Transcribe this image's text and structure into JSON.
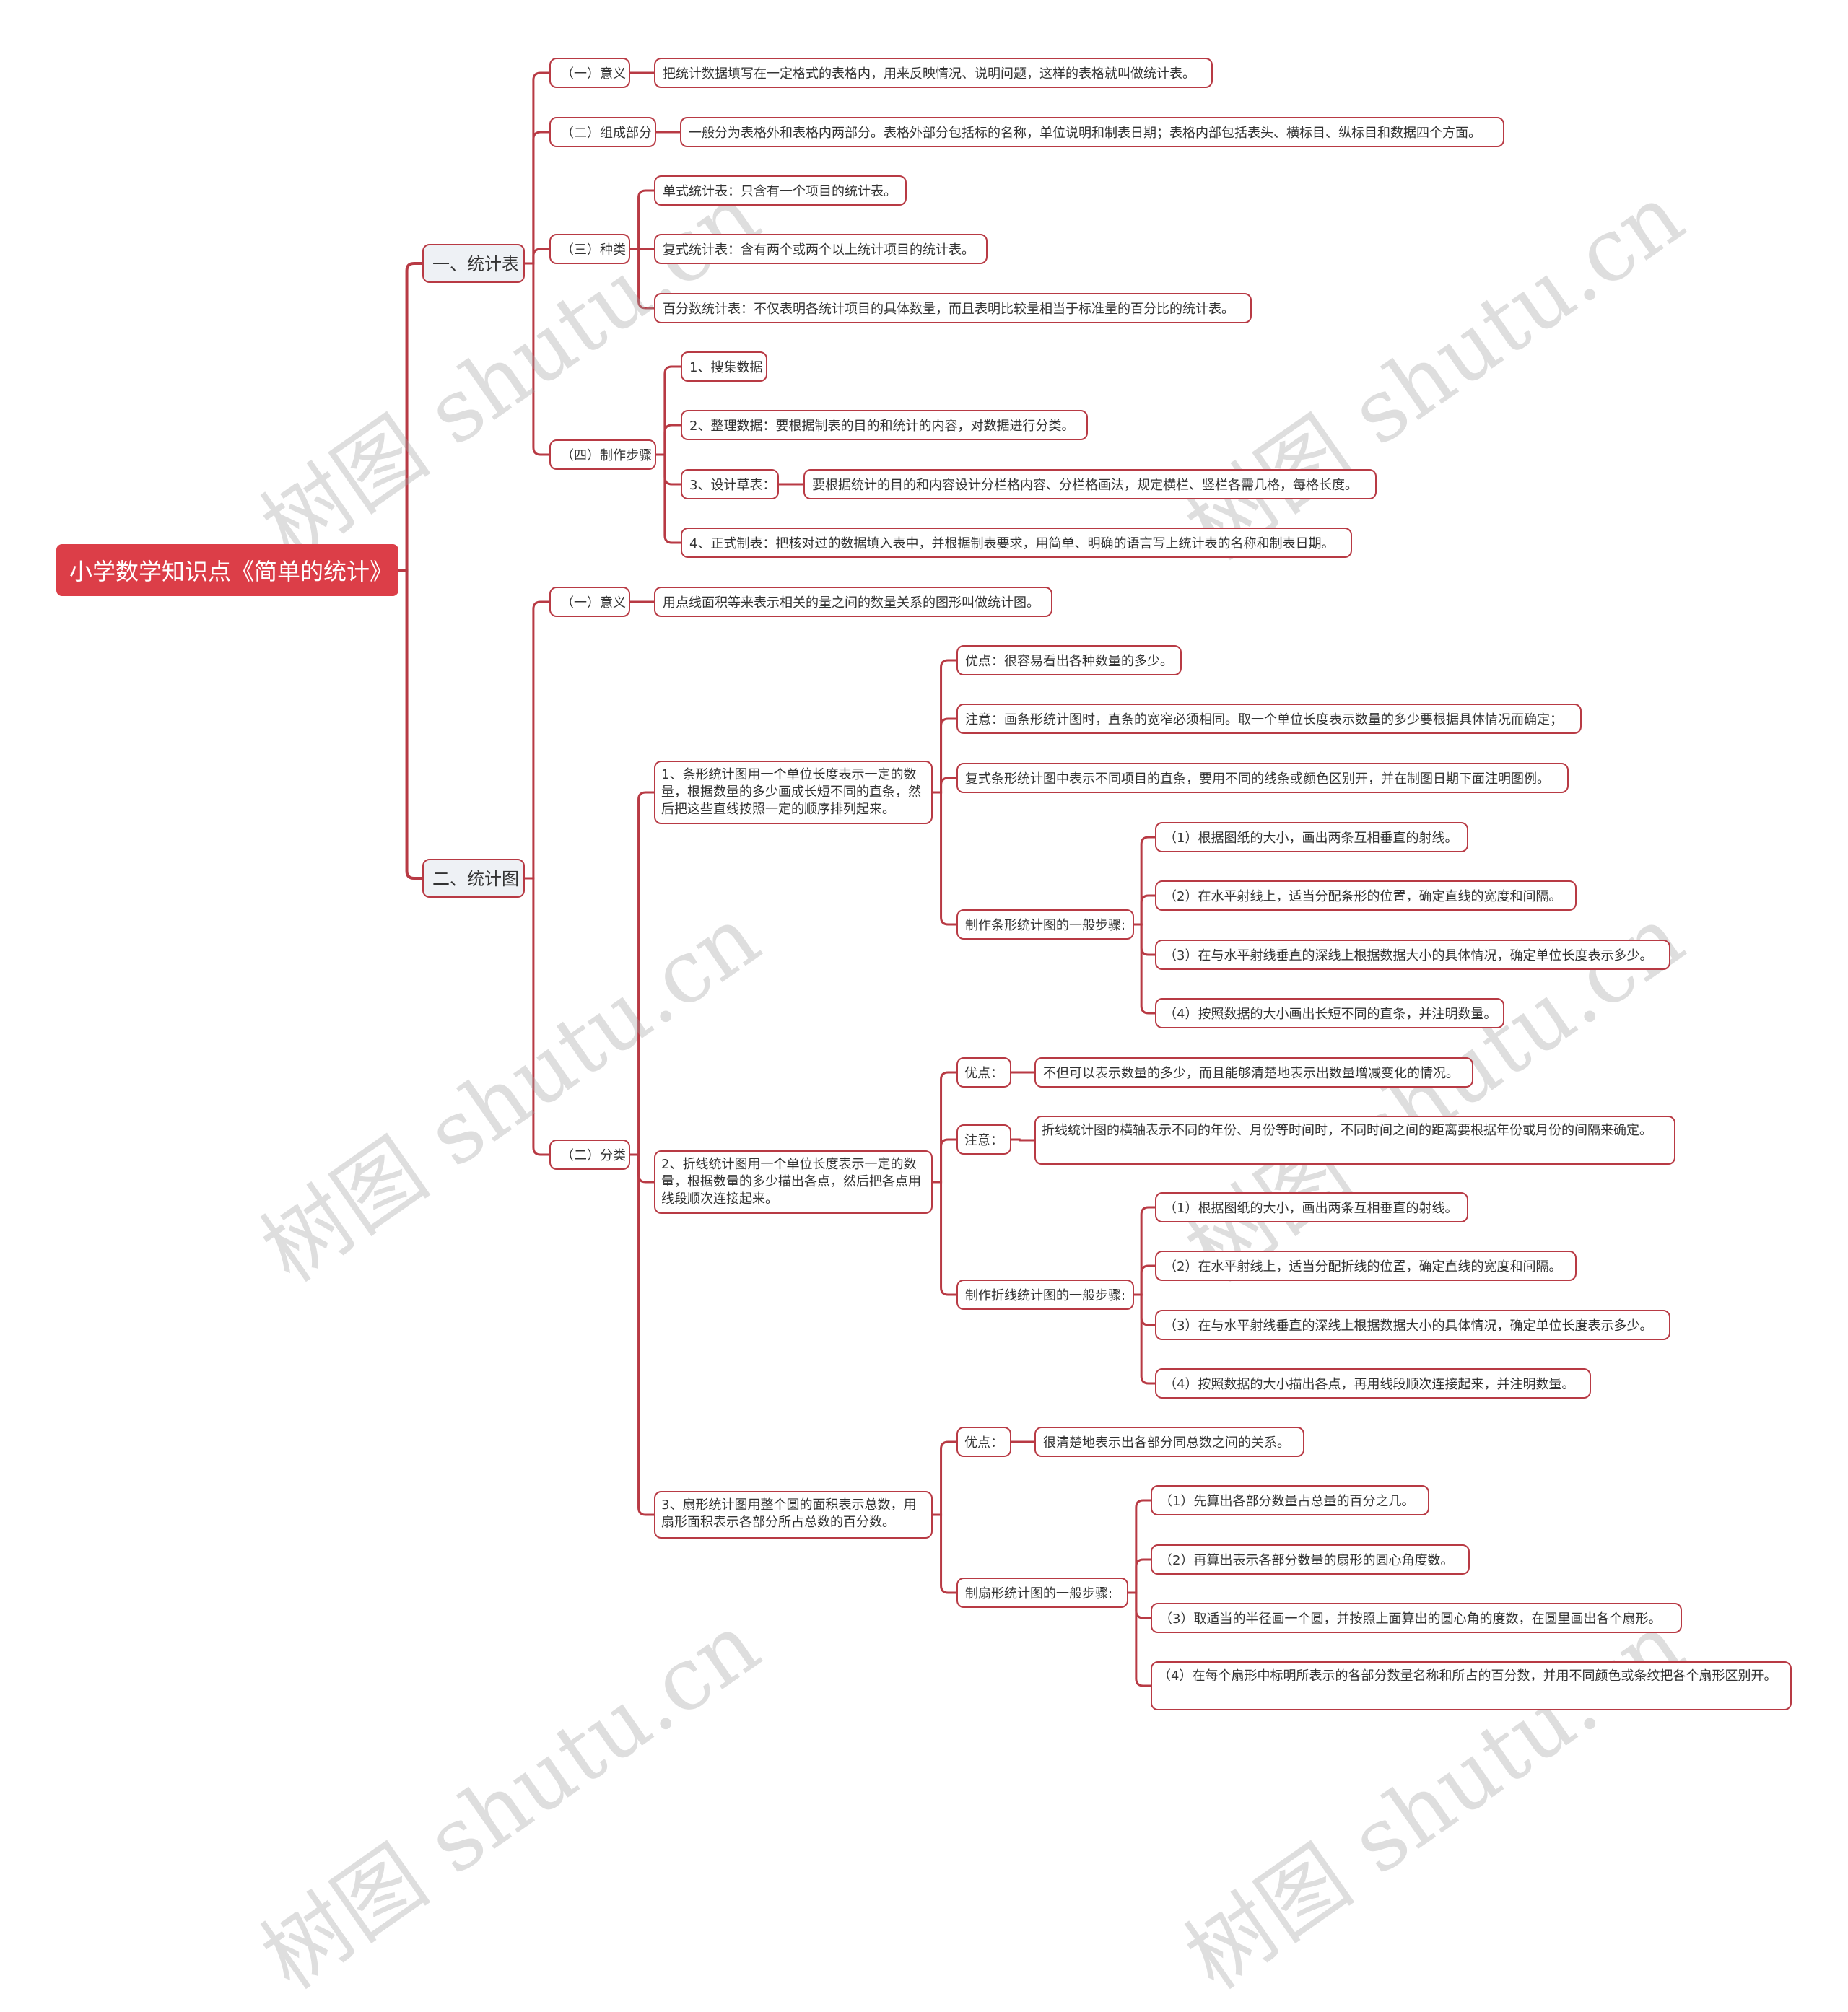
{
  "root": "小学数学知识点《简单的统计》",
  "branches": [
    {
      "label": "一、统计表",
      "children": [
        {
          "label": "（一）意义",
          "detail": "把统计数据填写在一定格式的表格内，用来反映情况、说明问题，这样的表格就叫做统计表。"
        },
        {
          "label": "（二）组成部分",
          "detail": "一般分为表格外和表格内两部分。表格外部分包括标的名称，单位说明和制表日期；表格内部包括表头、横标目、纵标目和数据四个方面。"
        },
        {
          "label": "（三）种类",
          "items": [
            "单式统计表：只含有一个项目的统计表。",
            "复式统计表：含有两个或两个以上统计项目的统计表。",
            "百分数统计表：不仅表明各统计项目的具体数量，而且表明比较量相当于标准量的百分比的统计表。"
          ]
        },
        {
          "label": "（四）制作步骤",
          "items": [
            "1、搜集数据",
            "2、整理数据：要根据制表的目的和统计的内容，对数据进行分类。",
            "3、设计草表：",
            "4、正式制表：把核对过的数据填入表中，并根据制表要求，用简单、明确的语言写上统计表的名称和制表日期。"
          ],
          "step3_detail": "要根据统计的目的和内容设计分栏格内容、分栏格画法，规定横栏、竖栏各需几格，每格长度。"
        }
      ]
    },
    {
      "label": "二、统计图",
      "children": [
        {
          "label": "（一）意义",
          "detail": "用点线面积等来表示相关的量之间的数量关系的图形叫做统计图。"
        },
        {
          "label": "（二）分类",
          "types": [
            {
              "label": "1、条形统计图用一个单位长度表示一定的数量，根据数量的多少画成长短不同的直条，然后把这些直线按照一定的顺序排列起来。",
              "advantage": "优点：很容易看出各种数量的多少。",
              "note": "注意：画条形统计图时，直条的宽窄必须相同。取一个单位长度表示数量的多少要根据具体情况而确定；",
              "extra": "复式条形统计图中表示不同项目的直条，要用不同的线条或颜色区别开，并在制图日期下面注明图例。",
              "steps_label": "制作条形统计图的一般步骤:",
              "steps": [
                "（1）根据图纸的大小，画出两条互相垂直的射线。",
                "（2）在水平射线上，适当分配条形的位置，确定直线的宽度和间隔。",
                "（3）在与水平射线垂直的深线上根据数据大小的具体情况，确定单位长度表示多少。",
                "（4）按照数据的大小画出长短不同的直条，并注明数量。"
              ]
            },
            {
              "label": "2、折线统计图用一个单位长度表示一定的数量，根据数量的多少描出各点，然后把各点用线段顺次连接起来。",
              "advantage_label": "优点：",
              "advantage": "不但可以表示数量的多少，而且能够清楚地表示出数量增减变化的情况。",
              "note_label": "注意：",
              "note": "折线统计图的横轴表示不同的年份、月份等时间时，不同时间之间的距离要根据年份或月份的间隔来确定。",
              "steps_label": "制作折线统计图的一般步骤:",
              "steps": [
                "（1）根据图纸的大小，画出两条互相垂直的射线。",
                "（2）在水平射线上，适当分配折线的位置，确定直线的宽度和间隔。",
                "（3）在与水平射线垂直的深线上根据数据大小的具体情况，确定单位长度表示多少。",
                "（4）按照数据的大小描出各点，再用线段顺次连接起来，并注明数量。"
              ]
            },
            {
              "label": "3、扇形统计图用整个圆的面积表示总数，用扇形面积表示各部分所占总数的百分数。",
              "advantage_label": "优点：",
              "advantage": "很清楚地表示出各部分同总数之间的关系。",
              "steps_label": "制扇形统计图的一般步骤:",
              "steps": [
                "（1）先算出各部分数量占总量的百分之几。",
                "（2）再算出表示各部分数量的扇形的圆心角度数。",
                "（3）取适当的半径画一个圆，并按照上面算出的圆心角的度数，在圆里画出各个扇形。",
                "（4）在每个扇形中标明所表示的各部分数量名称和所占的百分数，并用不同颜色或条纹把各个扇形区别开。"
              ]
            }
          ]
        }
      ]
    }
  ],
  "watermark": "树图 shutu.cn",
  "colors": {
    "accent": "#dc3e48",
    "line": "#b83a44",
    "l1_bg": "#eef1f5"
  }
}
